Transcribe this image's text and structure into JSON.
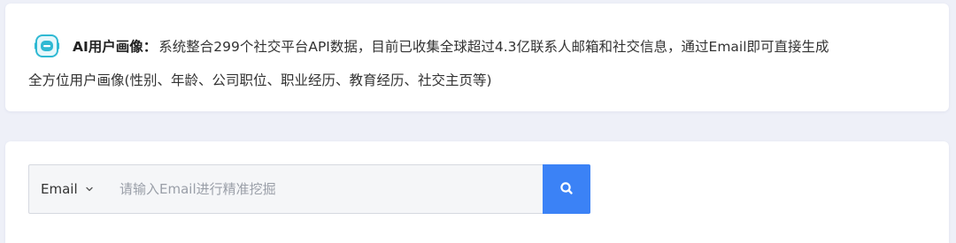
{
  "info": {
    "icon": "ai-robot-icon",
    "label": "AI用户画像：",
    "line1": "系统整合299个社交平台API数据，目前已收集全球超过4.3亿联系人邮箱和社交信息，通过Email即可直接生成",
    "line2": "全方位用户画像(性别、年龄、公司职位、职业经历、教育经历、社交主页等)"
  },
  "search": {
    "type_label": "Email",
    "type_icon": "chevron-down-icon",
    "placeholder": "请输入Email进行精准挖掘",
    "value": "",
    "button_icon": "search-icon"
  },
  "colors": {
    "accent": "#3b82f6",
    "page_bg": "#eef0f8",
    "icon_teal": "#2fb9d3"
  }
}
